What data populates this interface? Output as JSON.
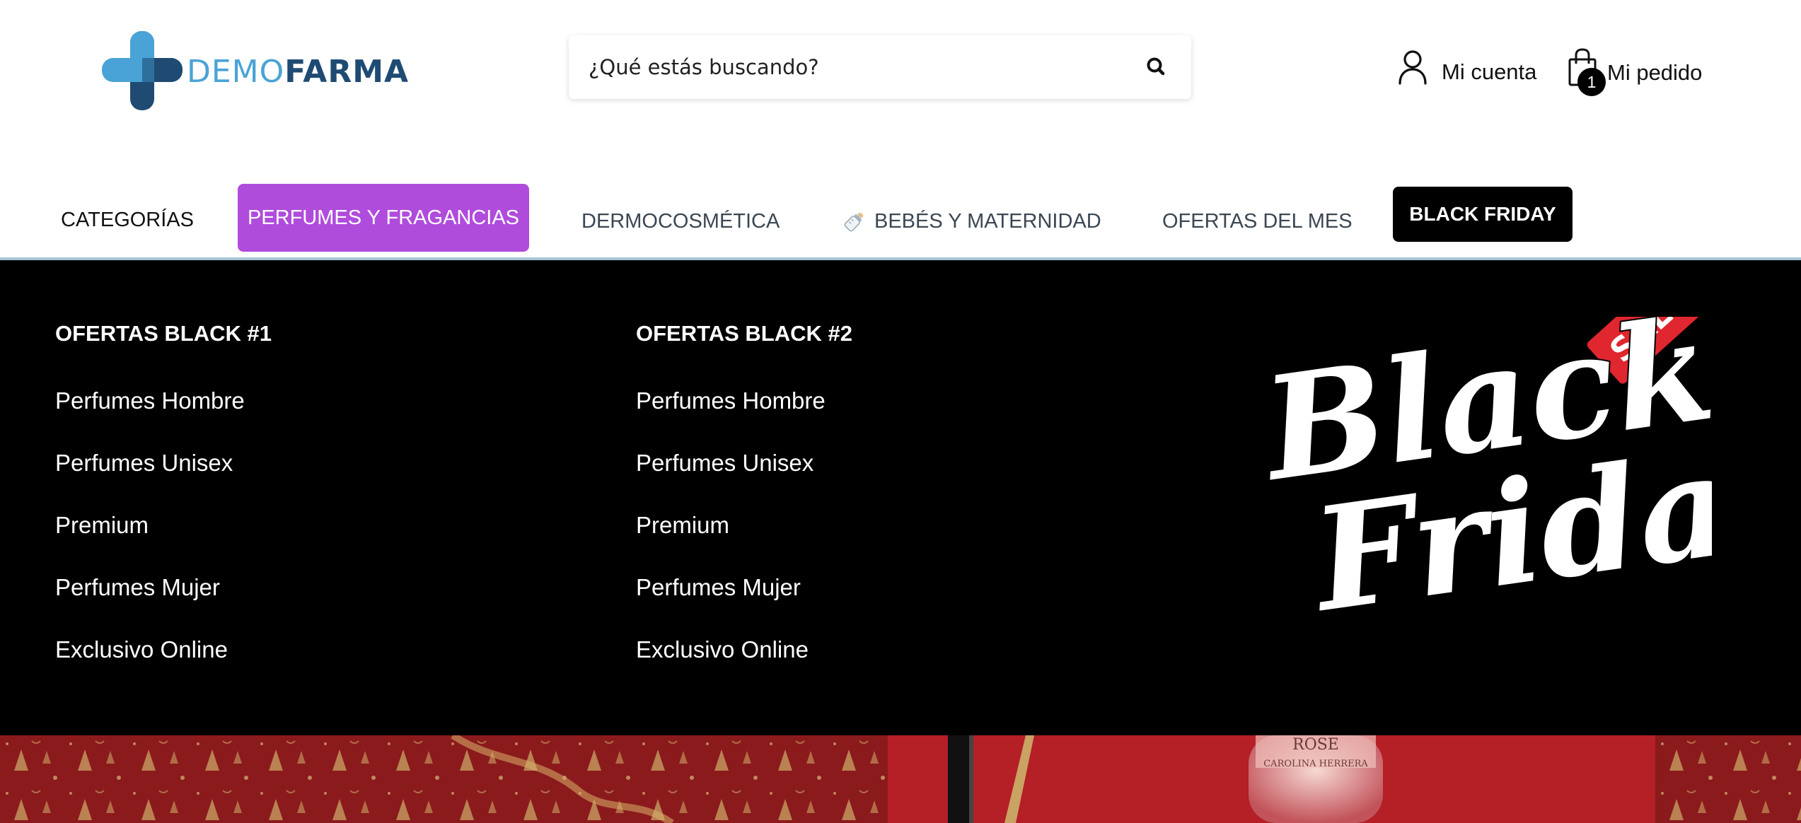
{
  "brand": {
    "name_part1": "DEMO",
    "name_part2": "FARMA"
  },
  "search": {
    "placeholder": "¿Qué estás buscando?"
  },
  "account": {
    "label": "Mi cuenta"
  },
  "order": {
    "label": "Mi pedido",
    "count": "1"
  },
  "nav": {
    "items": [
      {
        "label": "CATEGORÍAS"
      },
      {
        "label": "PERFUMES Y FRAGANCIAS",
        "active": true
      },
      {
        "label": "DERMOCOSMÉTICA"
      },
      {
        "label": "BEBÉS Y MATERNIDAD",
        "icon": "baby-bottle-icon"
      },
      {
        "label": "OFERTAS DEL MES"
      },
      {
        "label": "BLACK FRIDAY"
      }
    ]
  },
  "mega_menu": {
    "columns": [
      {
        "title": "OFERTAS BLACK #1",
        "links": [
          "Perfumes Hombre",
          "Perfumes Unisex",
          "Premium",
          "Perfumes Mujer",
          "Exclusivo Online"
        ]
      },
      {
        "title": "OFERTAS BLACK #2",
        "links": [
          "Perfumes Hombre",
          "Perfumes Unisex",
          "Premium",
          "Perfumes Mujer",
          "Exclusivo Online"
        ]
      }
    ],
    "promo": {
      "line1": "Black",
      "line2": "Friday",
      "tag": "SALE"
    }
  },
  "banner": {
    "product_name": "ROSE",
    "product_brand": "CAROLINA HERRERA"
  },
  "colors": {
    "accent_purple": "#b04cdc",
    "logo_light_blue": "#4aa3d6",
    "logo_dark_blue": "#1f4b73",
    "menu_background": "#000000",
    "banner_red": "#7d1417",
    "sale_red": "#e0262e"
  }
}
